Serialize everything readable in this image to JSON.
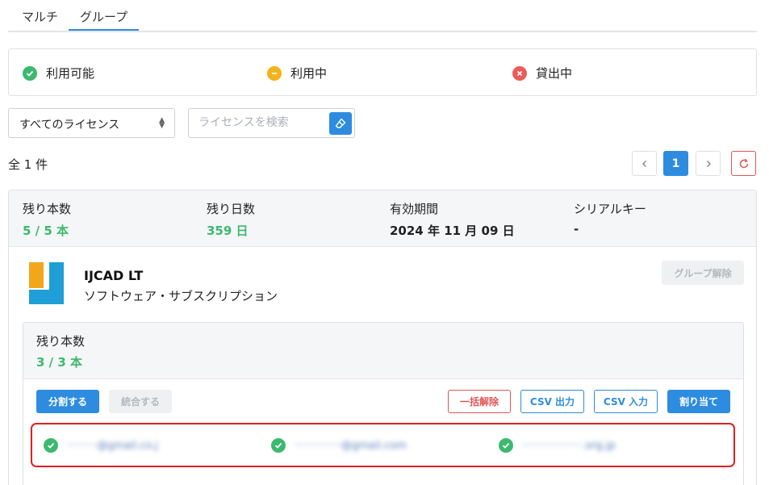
{
  "tabs": [
    {
      "label": "マルチ"
    },
    {
      "label": "グループ"
    }
  ],
  "status_legend": [
    {
      "label": "利用可能",
      "color": "#3cb96e",
      "icon": "check-circle-icon"
    },
    {
      "label": "利用中",
      "color": "#f4b21b",
      "icon": "minus-circle-icon"
    },
    {
      "label": "貸出中",
      "color": "#ee5b5b",
      "icon": "x-circle-icon"
    }
  ],
  "filter": {
    "select_value": "すべてのライセンス",
    "search_placeholder": "ライセンスを検索"
  },
  "result_count": "全 1 件",
  "pagination": {
    "current_page": "1"
  },
  "license": {
    "remaining_units_label": "残り本数",
    "remaining_units_value": "5 / 5 本",
    "remaining_days_label": "残り日数",
    "remaining_days_value": "359 日",
    "validity_label": "有効期間",
    "validity_value": "2024 年 11 月 09 日",
    "serial_label": "シリアルキー",
    "serial_value": "-",
    "product_name": "IJCAD LT",
    "product_subtitle": "ソフトウェア・サブスクリプション",
    "ungroup_label": "グループ解除"
  },
  "group": {
    "remaining_label": "残り本数",
    "remaining_value": "3 / 3 本",
    "buttons": {
      "split": "分割する",
      "merge": "統合する",
      "bulk_release": "一括解除",
      "csv_out": "CSV 出力",
      "csv_in": "CSV 入力",
      "assign": "割り当て"
    },
    "users": [
      {
        "email": "·········@gmail.co.j"
      },
      {
        "email": "··············@gmail.com"
      },
      {
        "email": "··················.org.jp"
      }
    ]
  },
  "colors": {
    "primary": "#2d8ce0",
    "available": "#3cb96e",
    "in_use": "#f4b21b",
    "lent": "#ee5b5b",
    "highlight_border": "#e02020"
  }
}
